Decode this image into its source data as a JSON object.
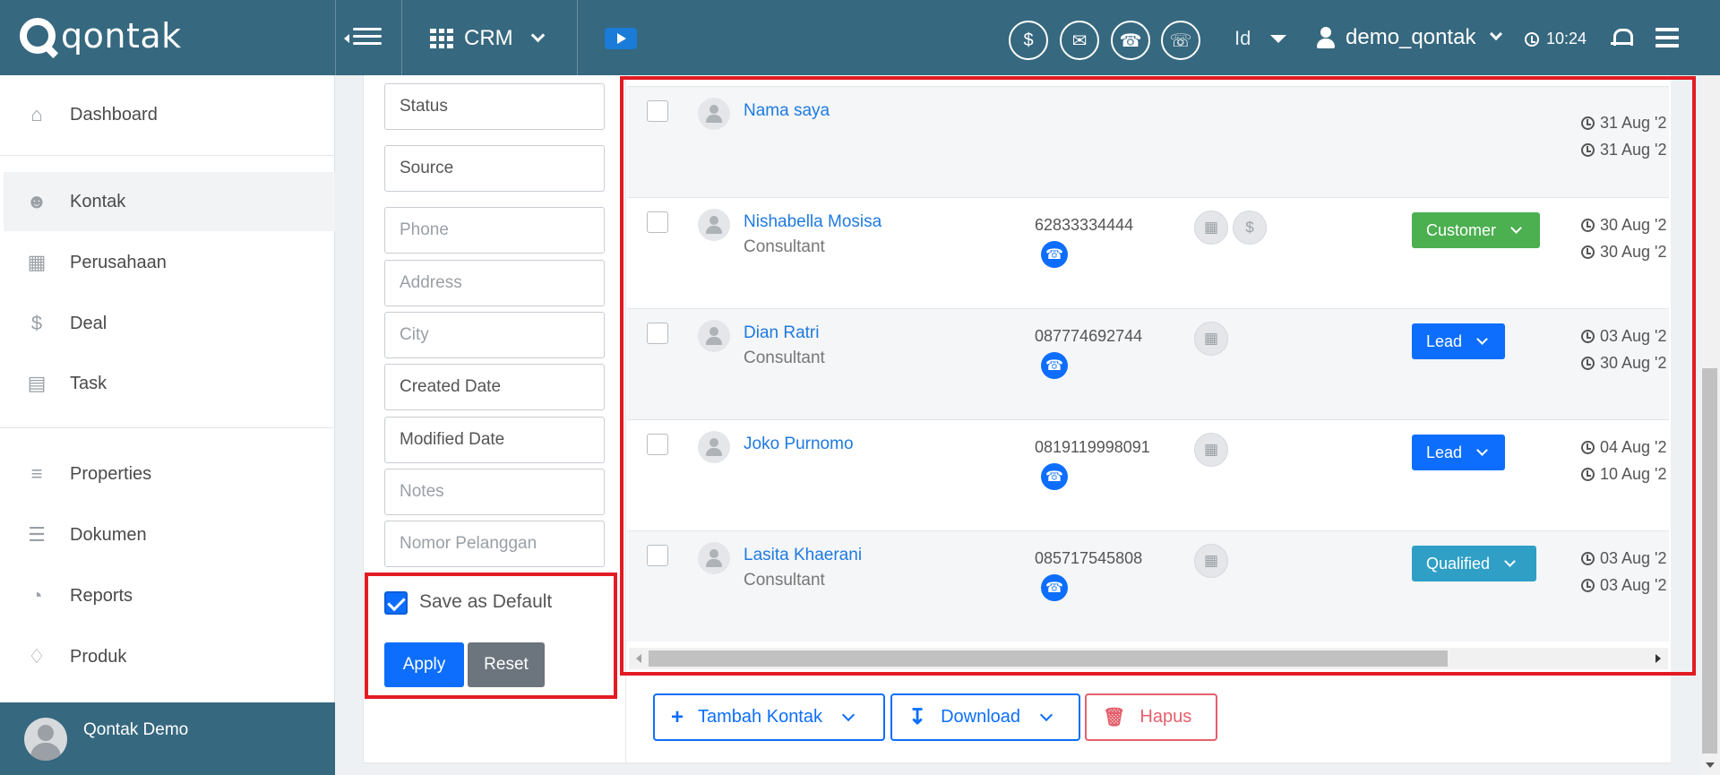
{
  "brand": {
    "name": "qontak"
  },
  "topbar": {
    "module": "CRM",
    "language": "Id",
    "username": "demo_qontak",
    "time": "10:24",
    "circle_icons": [
      "money-icon",
      "chat-icon",
      "phone-icon",
      "call-list-icon"
    ]
  },
  "sidebar": {
    "items": [
      {
        "label": "Dashboard",
        "icon": "home-icon"
      },
      {
        "label": "Kontak",
        "icon": "contacts-icon",
        "active": true
      },
      {
        "label": "Perusahaan",
        "icon": "building-icon"
      },
      {
        "label": "Deal",
        "icon": "dollar-icon"
      },
      {
        "label": "Task",
        "icon": "calendar-icon"
      },
      {
        "label": "Properties",
        "icon": "list-icon"
      },
      {
        "label": "Dokumen",
        "icon": "layers-icon"
      },
      {
        "label": "Reports",
        "icon": "pie-chart-icon"
      },
      {
        "label": "Produk",
        "icon": "tag-icon"
      }
    ],
    "footer_name": "Qontak Demo"
  },
  "filters": {
    "fields": [
      {
        "label": "Status",
        "placeholder": false
      },
      {
        "label": "Source",
        "placeholder": false
      },
      {
        "label": "Phone",
        "placeholder": true
      },
      {
        "label": "Address",
        "placeholder": true
      },
      {
        "label": "City",
        "placeholder": true
      },
      {
        "label": "Created Date",
        "placeholder": false
      },
      {
        "label": "Modified Date",
        "placeholder": false
      },
      {
        "label": "Notes",
        "placeholder": true
      },
      {
        "label": "Nomor Pelanggan",
        "placeholder": true
      }
    ],
    "save_default_label": "Save as Default",
    "save_default_checked": true,
    "apply_label": "Apply",
    "reset_label": "Reset"
  },
  "contacts": [
    {
      "name": "Nama saya",
      "job": "",
      "phone": "",
      "company_icons": [],
      "status": "",
      "date1": "31 Aug '2",
      "date2": "31 Aug '2"
    },
    {
      "name": "Nishabella Mosisa",
      "job": "Consultant",
      "phone": "62833334444",
      "company_icons": [
        "building-icon",
        "dollar-icon"
      ],
      "status": "Customer",
      "status_color": "#4caf50",
      "date1": "30 Aug '2",
      "date2": "30 Aug '2"
    },
    {
      "name": "Dian Ratri",
      "job": "Consultant",
      "phone": "087774692744",
      "company_icons": [
        "building-icon"
      ],
      "status": "Lead",
      "status_color": "#0d6efd",
      "date1": "03 Aug '2",
      "date2": "30 Aug '2"
    },
    {
      "name": "Joko Purnomo",
      "job": "",
      "phone": "0819119998091",
      "company_icons": [
        "building-icon"
      ],
      "status": "Lead",
      "status_color": "#0d6efd",
      "date1": "04 Aug '2",
      "date2": "10 Aug '2"
    },
    {
      "name": "Lasita Khaerani",
      "job": "Consultant",
      "phone": "085717545808",
      "company_icons": [
        "building-icon"
      ],
      "status": "Qualified",
      "status_color": "#2f9fc6",
      "date1": "03 Aug '2",
      "date2": "03 Aug '2"
    }
  ],
  "actions": {
    "add_label": "Tambah Kontak",
    "download_label": "Download",
    "delete_label": "Hapus"
  }
}
